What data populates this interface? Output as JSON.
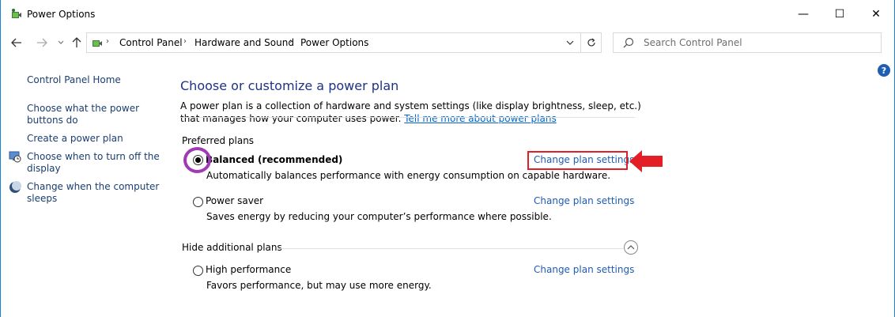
{
  "window": {
    "title": "Power Options",
    "minimize_glyph": "—",
    "maximize_glyph": "☐",
    "close_glyph": "✕"
  },
  "nav": {
    "back_icon": "back-arrow-icon",
    "forward_icon": "forward-arrow-icon",
    "recent_icon": "chevron-down-icon",
    "up_icon": "up-arrow-icon",
    "breadcrumb": [
      "Control Panel",
      "Hardware and Sound",
      "Power Options"
    ],
    "search_placeholder": "Search Control Panel"
  },
  "left_nav": {
    "home": "Control Panel Home",
    "buttons": "Choose what the power buttons do",
    "create": "Create a power plan",
    "display": "Choose when to turn off the display",
    "sleep": "Change when the computer sleeps"
  },
  "main": {
    "title": "Choose or customize a power plan",
    "description": "A power plan is a collection of hardware and system settings (like display brightness, sleep, etc.) that manages how your computer uses power.",
    "tell_more_link": "Tell me more about power plans",
    "preferred_header": "Preferred plans",
    "hide_header": "Hide additional plans",
    "plans": [
      {
        "name": "Balanced (recommended)",
        "desc": "Automatically balances performance with energy consumption on capable hardware.",
        "link": "Change plan settings",
        "selected": true
      },
      {
        "name": "Power saver",
        "desc": "Saves energy by reducing your computer’s performance where possible.",
        "link": "Change plan settings",
        "selected": false
      },
      {
        "name": "High performance",
        "desc": "Favors performance, but may use more energy.",
        "link": "Change plan settings",
        "selected": false
      }
    ]
  },
  "annotations": {
    "circle_color": "#a13ab5",
    "box_color": "#e41e26",
    "arrow_color": "#e41e26"
  }
}
